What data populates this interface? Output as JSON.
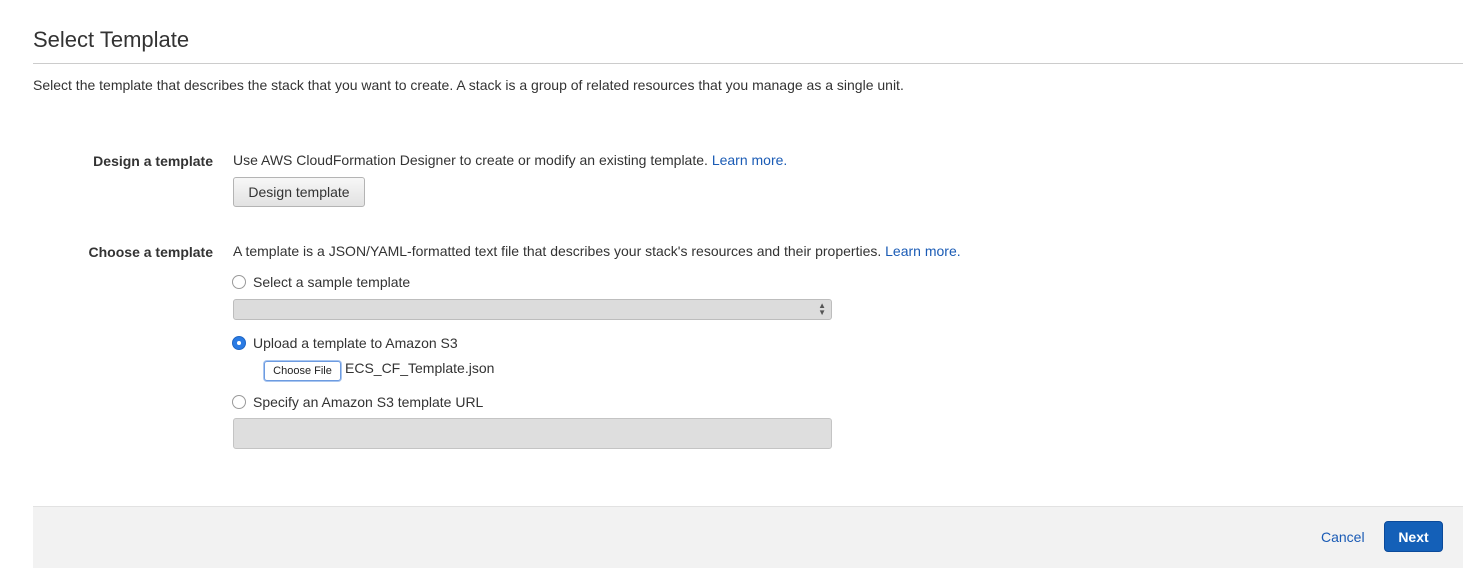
{
  "page": {
    "title": "Select Template",
    "description": "Select the template that describes the stack that you want to create. A stack is a group of related resources that you manage as a single unit."
  },
  "design_section": {
    "label": "Design a template",
    "text": "Use AWS CloudFormation Designer to create or modify an existing template.",
    "learn_more": "Learn more.",
    "button_label": "Design template"
  },
  "choose_section": {
    "label": "Choose a template",
    "text": "A template is a JSON/YAML-formatted text file that describes your stack's resources and their properties.",
    "learn_more": "Learn more.",
    "options": [
      {
        "label": "Select a sample template",
        "checked": false
      },
      {
        "label": "Upload a template to Amazon S3",
        "checked": true
      },
      {
        "label": "Specify an Amazon S3 template URL",
        "checked": false
      }
    ],
    "sample_select_value": "",
    "choose_file_label": "Choose File",
    "file_name": "ECS_CF_Template.json",
    "url_value": ""
  },
  "footer": {
    "cancel_label": "Cancel",
    "next_label": "Next"
  },
  "colors": {
    "link": "#1a5bb5",
    "primary_button": "#1460b8",
    "radio_checked": "#2a7be4"
  },
  "icons": {
    "select_arrows": "updown-arrows-icon"
  }
}
